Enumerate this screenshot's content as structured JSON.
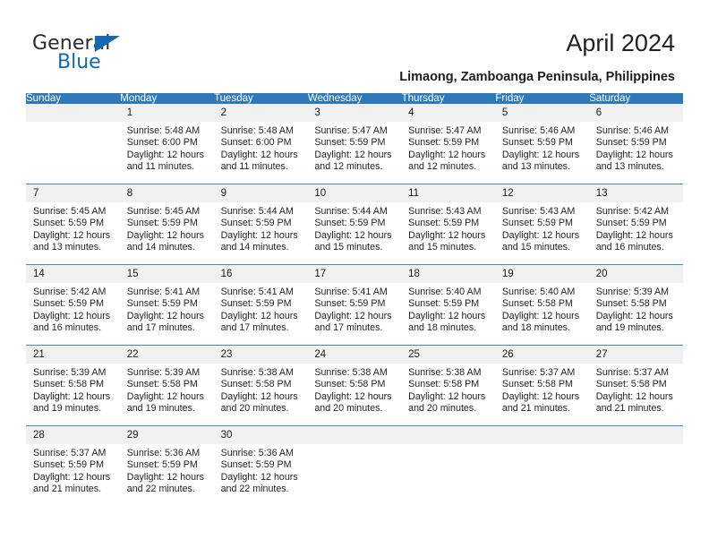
{
  "brand": {
    "name_dark": "General",
    "name_blue": "Blue",
    "accent_color": "#1268b3"
  },
  "header": {
    "title": "April 2024",
    "subtitle": "Limaong, Zamboanga Peninsula, Philippines"
  },
  "theme": {
    "header_row_color": "#2e7ab8",
    "day_number_bg": "#f0f0f0",
    "week_divider_color": "#4a85bd"
  },
  "calendar": {
    "weekday_headers": [
      "Sunday",
      "Monday",
      "Tuesday",
      "Wednesday",
      "Thursday",
      "Friday",
      "Saturday"
    ],
    "weeks": [
      [
        {
          "day": "",
          "blank": true,
          "sunrise": "",
          "sunset": "",
          "daylight_line1": "",
          "daylight_line2": ""
        },
        {
          "day": "1",
          "sunrise": "Sunrise: 5:48 AM",
          "sunset": "Sunset: 6:00 PM",
          "daylight_line1": "Daylight: 12 hours",
          "daylight_line2": "and 11 minutes."
        },
        {
          "day": "2",
          "sunrise": "Sunrise: 5:48 AM",
          "sunset": "Sunset: 6:00 PM",
          "daylight_line1": "Daylight: 12 hours",
          "daylight_line2": "and 11 minutes."
        },
        {
          "day": "3",
          "sunrise": "Sunrise: 5:47 AM",
          "sunset": "Sunset: 5:59 PM",
          "daylight_line1": "Daylight: 12 hours",
          "daylight_line2": "and 12 minutes."
        },
        {
          "day": "4",
          "sunrise": "Sunrise: 5:47 AM",
          "sunset": "Sunset: 5:59 PM",
          "daylight_line1": "Daylight: 12 hours",
          "daylight_line2": "and 12 minutes."
        },
        {
          "day": "5",
          "sunrise": "Sunrise: 5:46 AM",
          "sunset": "Sunset: 5:59 PM",
          "daylight_line1": "Daylight: 12 hours",
          "daylight_line2": "and 13 minutes."
        },
        {
          "day": "6",
          "sunrise": "Sunrise: 5:46 AM",
          "sunset": "Sunset: 5:59 PM",
          "daylight_line1": "Daylight: 12 hours",
          "daylight_line2": "and 13 minutes."
        }
      ],
      [
        {
          "day": "7",
          "sunrise": "Sunrise: 5:45 AM",
          "sunset": "Sunset: 5:59 PM",
          "daylight_line1": "Daylight: 12 hours",
          "daylight_line2": "and 13 minutes."
        },
        {
          "day": "8",
          "sunrise": "Sunrise: 5:45 AM",
          "sunset": "Sunset: 5:59 PM",
          "daylight_line1": "Daylight: 12 hours",
          "daylight_line2": "and 14 minutes."
        },
        {
          "day": "9",
          "sunrise": "Sunrise: 5:44 AM",
          "sunset": "Sunset: 5:59 PM",
          "daylight_line1": "Daylight: 12 hours",
          "daylight_line2": "and 14 minutes."
        },
        {
          "day": "10",
          "sunrise": "Sunrise: 5:44 AM",
          "sunset": "Sunset: 5:59 PM",
          "daylight_line1": "Daylight: 12 hours",
          "daylight_line2": "and 15 minutes."
        },
        {
          "day": "11",
          "sunrise": "Sunrise: 5:43 AM",
          "sunset": "Sunset: 5:59 PM",
          "daylight_line1": "Daylight: 12 hours",
          "daylight_line2": "and 15 minutes."
        },
        {
          "day": "12",
          "sunrise": "Sunrise: 5:43 AM",
          "sunset": "Sunset: 5:59 PM",
          "daylight_line1": "Daylight: 12 hours",
          "daylight_line2": "and 15 minutes."
        },
        {
          "day": "13",
          "sunrise": "Sunrise: 5:42 AM",
          "sunset": "Sunset: 5:59 PM",
          "daylight_line1": "Daylight: 12 hours",
          "daylight_line2": "and 16 minutes."
        }
      ],
      [
        {
          "day": "14",
          "sunrise": "Sunrise: 5:42 AM",
          "sunset": "Sunset: 5:59 PM",
          "daylight_line1": "Daylight: 12 hours",
          "daylight_line2": "and 16 minutes."
        },
        {
          "day": "15",
          "sunrise": "Sunrise: 5:41 AM",
          "sunset": "Sunset: 5:59 PM",
          "daylight_line1": "Daylight: 12 hours",
          "daylight_line2": "and 17 minutes."
        },
        {
          "day": "16",
          "sunrise": "Sunrise: 5:41 AM",
          "sunset": "Sunset: 5:59 PM",
          "daylight_line1": "Daylight: 12 hours",
          "daylight_line2": "and 17 minutes."
        },
        {
          "day": "17",
          "sunrise": "Sunrise: 5:41 AM",
          "sunset": "Sunset: 5:59 PM",
          "daylight_line1": "Daylight: 12 hours",
          "daylight_line2": "and 17 minutes."
        },
        {
          "day": "18",
          "sunrise": "Sunrise: 5:40 AM",
          "sunset": "Sunset: 5:59 PM",
          "daylight_line1": "Daylight: 12 hours",
          "daylight_line2": "and 18 minutes."
        },
        {
          "day": "19",
          "sunrise": "Sunrise: 5:40 AM",
          "sunset": "Sunset: 5:58 PM",
          "daylight_line1": "Daylight: 12 hours",
          "daylight_line2": "and 18 minutes."
        },
        {
          "day": "20",
          "sunrise": "Sunrise: 5:39 AM",
          "sunset": "Sunset: 5:58 PM",
          "daylight_line1": "Daylight: 12 hours",
          "daylight_line2": "and 19 minutes."
        }
      ],
      [
        {
          "day": "21",
          "sunrise": "Sunrise: 5:39 AM",
          "sunset": "Sunset: 5:58 PM",
          "daylight_line1": "Daylight: 12 hours",
          "daylight_line2": "and 19 minutes."
        },
        {
          "day": "22",
          "sunrise": "Sunrise: 5:39 AM",
          "sunset": "Sunset: 5:58 PM",
          "daylight_line1": "Daylight: 12 hours",
          "daylight_line2": "and 19 minutes."
        },
        {
          "day": "23",
          "sunrise": "Sunrise: 5:38 AM",
          "sunset": "Sunset: 5:58 PM",
          "daylight_line1": "Daylight: 12 hours",
          "daylight_line2": "and 20 minutes."
        },
        {
          "day": "24",
          "sunrise": "Sunrise: 5:38 AM",
          "sunset": "Sunset: 5:58 PM",
          "daylight_line1": "Daylight: 12 hours",
          "daylight_line2": "and 20 minutes."
        },
        {
          "day": "25",
          "sunrise": "Sunrise: 5:38 AM",
          "sunset": "Sunset: 5:58 PM",
          "daylight_line1": "Daylight: 12 hours",
          "daylight_line2": "and 20 minutes."
        },
        {
          "day": "26",
          "sunrise": "Sunrise: 5:37 AM",
          "sunset": "Sunset: 5:58 PM",
          "daylight_line1": "Daylight: 12 hours",
          "daylight_line2": "and 21 minutes."
        },
        {
          "day": "27",
          "sunrise": "Sunrise: 5:37 AM",
          "sunset": "Sunset: 5:58 PM",
          "daylight_line1": "Daylight: 12 hours",
          "daylight_line2": "and 21 minutes."
        }
      ],
      [
        {
          "day": "28",
          "sunrise": "Sunrise: 5:37 AM",
          "sunset": "Sunset: 5:59 PM",
          "daylight_line1": "Daylight: 12 hours",
          "daylight_line2": "and 21 minutes."
        },
        {
          "day": "29",
          "sunrise": "Sunrise: 5:36 AM",
          "sunset": "Sunset: 5:59 PM",
          "daylight_line1": "Daylight: 12 hours",
          "daylight_line2": "and 22 minutes."
        },
        {
          "day": "30",
          "sunrise": "Sunrise: 5:36 AM",
          "sunset": "Sunset: 5:59 PM",
          "daylight_line1": "Daylight: 12 hours",
          "daylight_line2": "and 22 minutes."
        },
        {
          "day": "",
          "blank": true,
          "sunrise": "",
          "sunset": "",
          "daylight_line1": "",
          "daylight_line2": ""
        },
        {
          "day": "",
          "blank": true,
          "sunrise": "",
          "sunset": "",
          "daylight_line1": "",
          "daylight_line2": ""
        },
        {
          "day": "",
          "blank": true,
          "sunrise": "",
          "sunset": "",
          "daylight_line1": "",
          "daylight_line2": ""
        },
        {
          "day": "",
          "blank": true,
          "sunrise": "",
          "sunset": "",
          "daylight_line1": "",
          "daylight_line2": ""
        }
      ]
    ]
  }
}
